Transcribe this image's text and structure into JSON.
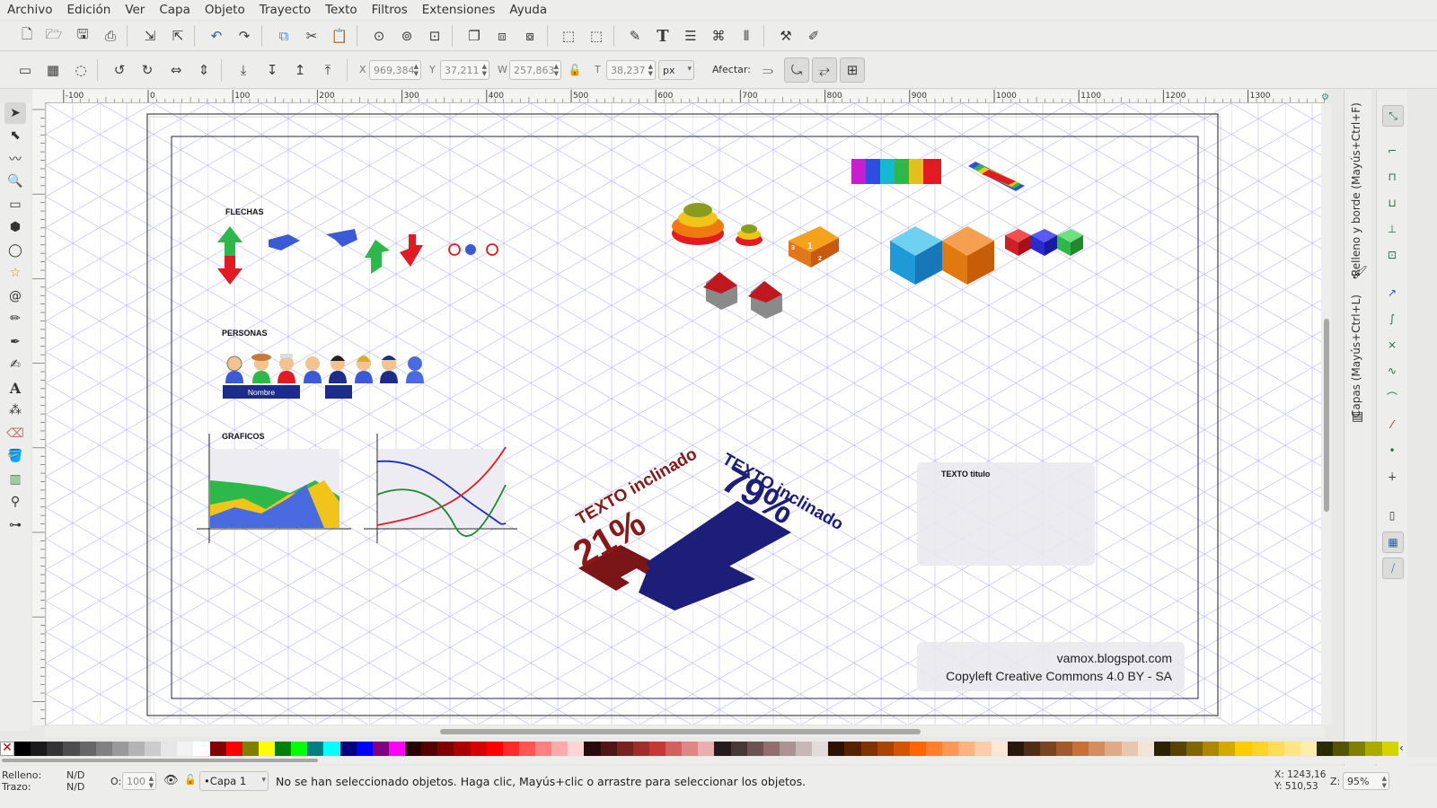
{
  "menu": [
    "Archivo",
    "Edición",
    "Ver",
    "Capa",
    "Objeto",
    "Trayecto",
    "Texto",
    "Filtros",
    "Extensiones",
    "Ayuda"
  ],
  "controls": {
    "x_label": "X",
    "x_value": "969,384",
    "y_label": "Y",
    "y_value": "37,211",
    "w_label": "W",
    "w_value": "257,863",
    "h_label": "T",
    "h_value": "38,237",
    "unit": "px",
    "affect_label": "Afectar:"
  },
  "ruler_ticks": [
    "-100",
    "0",
    "100",
    "200",
    "300",
    "400",
    "500",
    "600",
    "700",
    "800",
    "900",
    "1000",
    "1100",
    "1200",
    "1300"
  ],
  "docks": {
    "fill_stroke": "Relleno y borde (Mayús+Ctrl+F)",
    "layers": "Capas (Mayús+Ctrl+L)"
  },
  "drawing": {
    "flechas": "FLECHAS",
    "personas": "PERSONAS",
    "nombre": "Nombre",
    "graficos": "GRAFICOS",
    "texto_inclinado_1": "TEXTO inclinado",
    "pct_21": "21%",
    "texto_inclinado_2": "TEXTO inclinado",
    "pct_79": "79%",
    "texto_titulo": "TEXTO titulo",
    "footer_url": "vamox.blogspot.com",
    "footer_license": "Copyleft Creative Commons 4.0 BY - SA"
  },
  "status": {
    "fill_label": "Relleno:",
    "fill_value": "N/D",
    "stroke_label": "Trazo:",
    "stroke_value": "N/D",
    "opacity_label": "O:",
    "opacity_value": "100",
    "layer": "•Capa 1",
    "message": "No se han seleccionado objetos. Haga clic, Mayús+clic o arrastre para seleccionar los objetos.",
    "cursor_x": "X: 1243,16",
    "cursor_y": "Y:   510,53",
    "zoom_label": "Z:",
    "zoom_value": "95%"
  },
  "palette": [
    "#000000",
    "#1a1a1a",
    "#333333",
    "#4d4d4d",
    "#666666",
    "#808080",
    "#999999",
    "#b3b3b3",
    "#cccccc",
    "#e6e6e6",
    "#f2f2f2",
    "#ffffff",
    "#800000",
    "#ff0000",
    "#808000",
    "#ffff00",
    "#008000",
    "#00ff00",
    "#008080",
    "#00ffff",
    "#000080",
    "#0000ff",
    "#800080",
    "#ff00ff",
    "#2b0000",
    "#550000",
    "#800000",
    "#aa0000",
    "#d40000",
    "#ff0000",
    "#ff2a2a",
    "#ff5555",
    "#ff8080",
    "#ffaaaa",
    "#ffd5d5",
    "#280b0b",
    "#501616",
    "#782121",
    "#a02c2c",
    "#c83737",
    "#d35f5f",
    "#de8787",
    "#e9afaf",
    "#241c1c",
    "#483737",
    "#6c5353",
    "#916f6f",
    "#ac9393",
    "#c8b7b7",
    "#e3dbdb",
    "#2b1100",
    "#552200",
    "#803300",
    "#aa4400",
    "#d45500",
    "#ff6600",
    "#ff7f2a",
    "#ff9955",
    "#ffb380",
    "#ffccaa",
    "#ffe6d5",
    "#28170b",
    "#502d16",
    "#784421",
    "#a05a2c",
    "#c87137",
    "#d38d5f",
    "#deaa87",
    "#e9c6af",
    "#f4e3d7",
    "#2b2200",
    "#554400",
    "#806600",
    "#aa8800",
    "#d4aa00",
    "#ffcc00",
    "#ffd42a",
    "#ffdd55",
    "#ffe680",
    "#ffeeaa",
    "#2b2b00",
    "#555500",
    "#808000",
    "#aaaa00",
    "#d4d400"
  ]
}
